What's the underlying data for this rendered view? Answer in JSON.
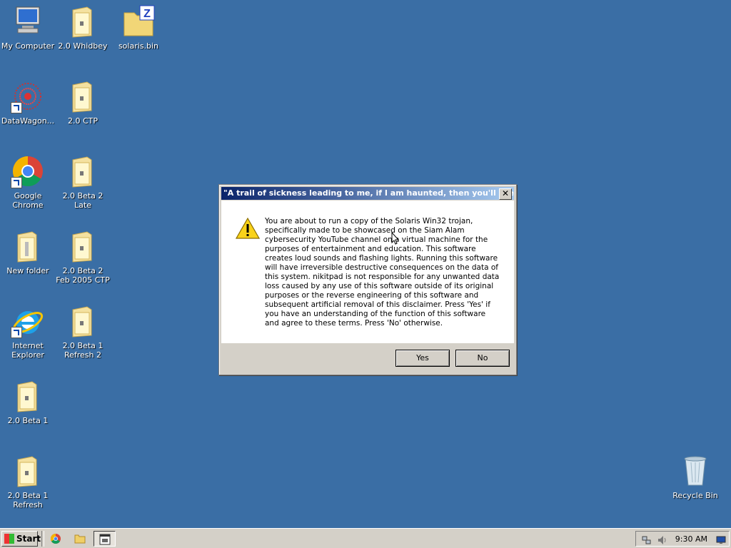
{
  "desktop": {
    "icons": [
      {
        "label": "My Computer"
      },
      {
        "label": "2.0 Whidbey"
      },
      {
        "label": "solaris.bin"
      },
      {
        "label": "DataWagon..."
      },
      {
        "label": "2.0 CTP"
      },
      {
        "label": "Google Chrome"
      },
      {
        "label": "2.0 Beta 2 Late"
      },
      {
        "label": "New folder"
      },
      {
        "label": "2.0 Beta 2 Feb 2005 CTP"
      },
      {
        "label": "Internet Explorer"
      },
      {
        "label": "2.0 Beta 1 Refresh 2"
      },
      {
        "label": "2.0 Beta 1"
      },
      {
        "label": "2.0 Beta 1 Refresh"
      },
      {
        "label": "Recycle Bin"
      }
    ]
  },
  "dialog": {
    "title": "\"A trail of sickness leading to me, if I am haunted, then you'll see...\"",
    "message": "You are about to run a copy of the Solaris Win32 trojan, specifically made to be showcased on the Siam Alam cybersecurity YouTube channel on a virtual machine for the purposes of entertainment and education. This software creates loud sounds and flashing lights. Running this software will have irreversible destructive consequences on the data of this system. nikitpad is not responsible for any unwanted data loss caused by any use of this software outside of its original purposes or the reverse engineering of this software and subsequent artificial removal of this disclaimer. Press 'Yes' if you have an understanding of the function of this software and agree to these terms. Press 'No' otherwise.",
    "yes_label": "Yes",
    "no_label": "No",
    "close_glyph": "✕"
  },
  "taskbar": {
    "start_label": "Start",
    "clock": "9:30 AM"
  },
  "icons": [
    "computer-icon",
    "folder-icon",
    "archive-icon",
    "shortcut-icon",
    "chrome-icon",
    "ie-icon",
    "recycle-bin-icon",
    "warning-icon"
  ],
  "colors": {
    "desktop": "#3a6ea5",
    "taskbar": "#d4d0c8",
    "titlebar": "#0a246a"
  }
}
